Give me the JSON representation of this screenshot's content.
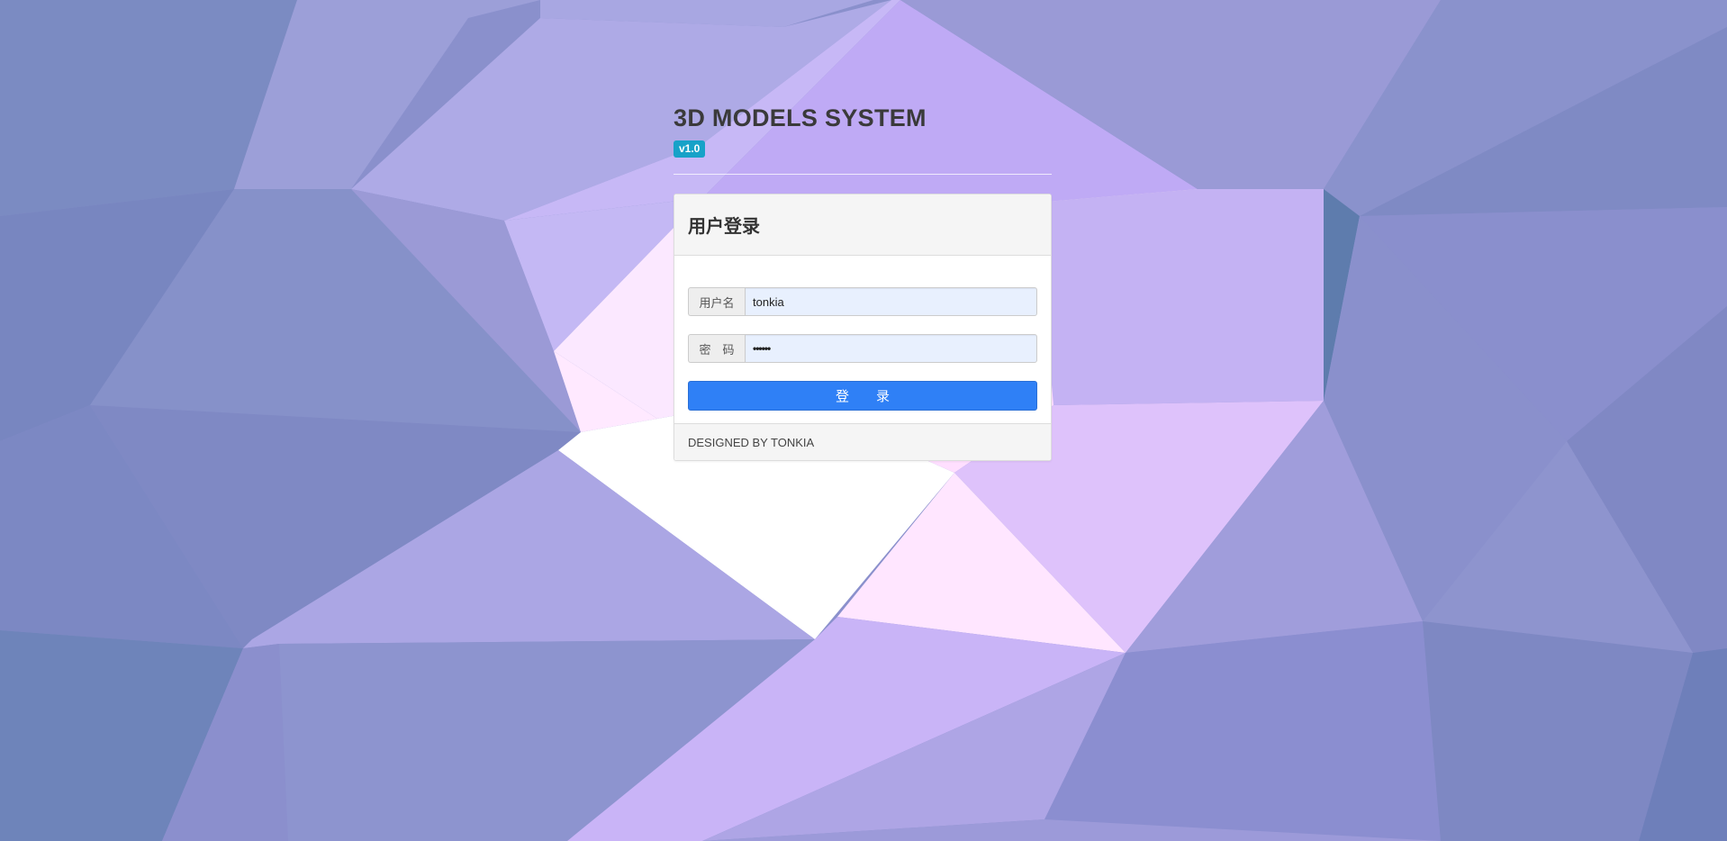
{
  "header": {
    "title": "3D MODELS SYSTEM",
    "version_badge": "v1.0"
  },
  "login_panel": {
    "title": "用户登录",
    "username": {
      "label": "用户名",
      "value": "tonkia"
    },
    "password": {
      "label": "密　码",
      "masked_value": "••••••"
    },
    "submit_label": "登　　录",
    "footer": "DESIGNED BY TONKIA"
  },
  "colors": {
    "badge": "#17a2c8",
    "primary_button": "#2f80f6",
    "autofill_field": "#e8f0fe"
  }
}
